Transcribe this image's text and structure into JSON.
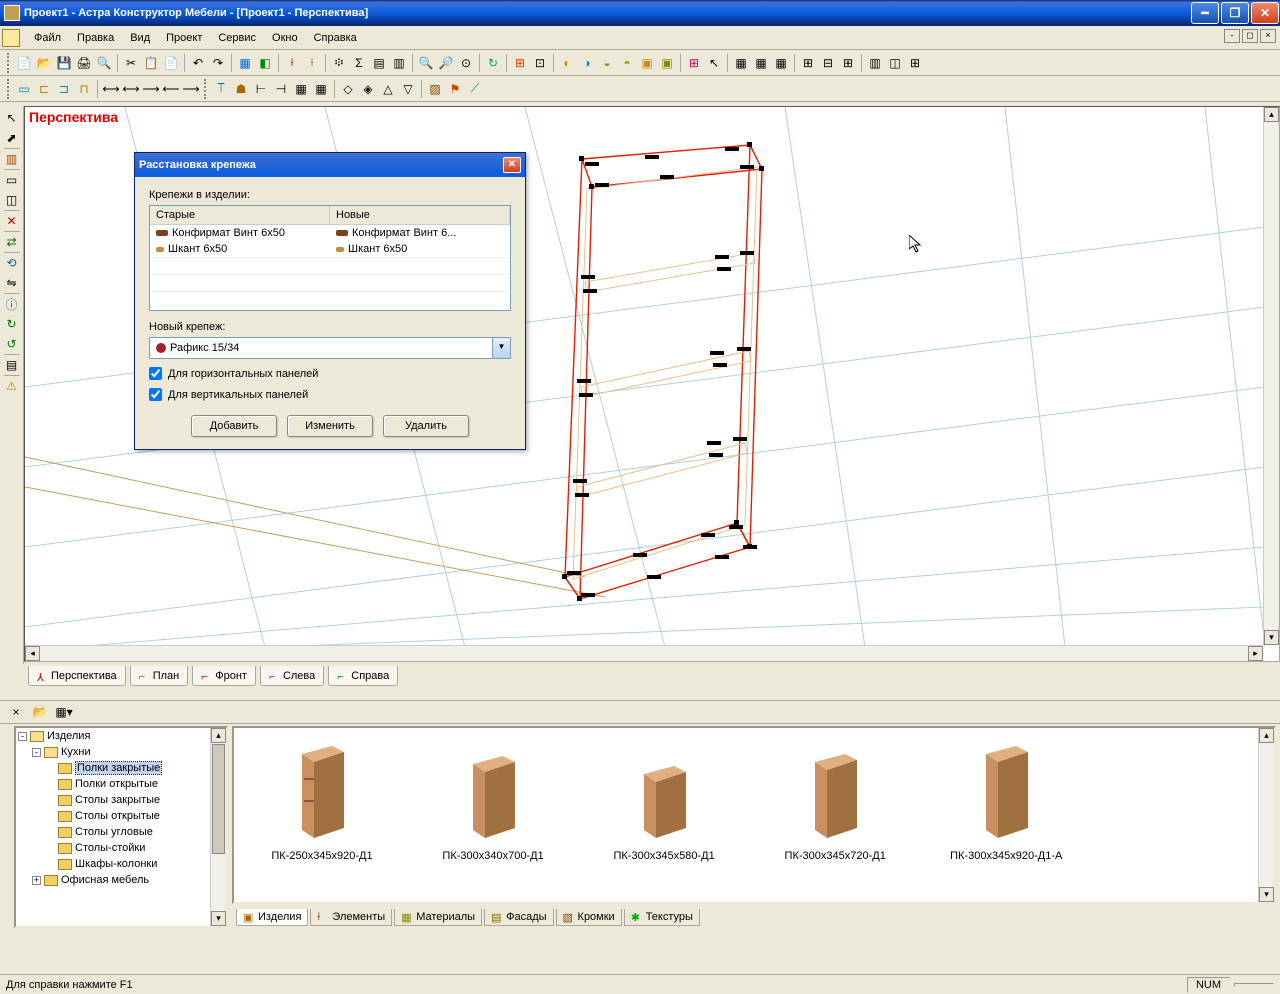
{
  "window": {
    "title": "Проект1 - Астра Конструктор Мебели - [Проект1 - Перспектива]"
  },
  "menu": {
    "file": "Файл",
    "edit": "Правка",
    "view": "Вид",
    "project": "Проект",
    "service": "Сервис",
    "window": "Окно",
    "help": "Справка"
  },
  "viewport": {
    "label": "Перспектива"
  },
  "dialog": {
    "title": "Расстановка крепежа",
    "list_label": "Крепежи в изделии:",
    "col_old": "Старые",
    "col_new": "Новые",
    "rows": [
      {
        "old": "Конфирмат Винт 6x50",
        "new": "Конфирмат Винт 6..."
      },
      {
        "old": "Шкант 6x50",
        "new": "Шкант 6x50"
      }
    ],
    "new_label": "Новый крепеж:",
    "combo_value": "Рафикс 15/34",
    "check_horiz": "Для горизонтальных панелей",
    "check_vert": "Для вертикальных панелей",
    "btn_add": "Добавить",
    "btn_edit": "Изменить",
    "btn_delete": "Удалить"
  },
  "view_tabs": {
    "perspective": "Перспектива",
    "plan": "План",
    "front": "Фронт",
    "left": "Слева",
    "right": "Справа"
  },
  "tree": {
    "root": "Изделия",
    "kitchens": "Кухни",
    "shelves_closed": "Полки закрытые",
    "shelves_open": "Полки открытые",
    "tables_closed": "Столы закрытые",
    "tables_open": "Столы открытые",
    "tables_corner": "Столы угловые",
    "tables_stand": "Столы-стойки",
    "cabinets_columns": "Шкафы-колонки",
    "office": "Офисная мебель"
  },
  "thumbs": [
    "ПК-250х345х920-Д1",
    "ПК-300х340х700-Д1",
    "ПК-300х345х580-Д1",
    "ПК-300х345х720-Д1",
    "ПК-300х345х920-Д1-А"
  ],
  "bottom_tabs": {
    "products": "Изделия",
    "elements": "Элементы",
    "materials": "Материалы",
    "facades": "Фасады",
    "edges": "Кромки",
    "textures": "Текстуры"
  },
  "status": {
    "hint": "Для справки нажмите F1",
    "num": "NUM"
  }
}
